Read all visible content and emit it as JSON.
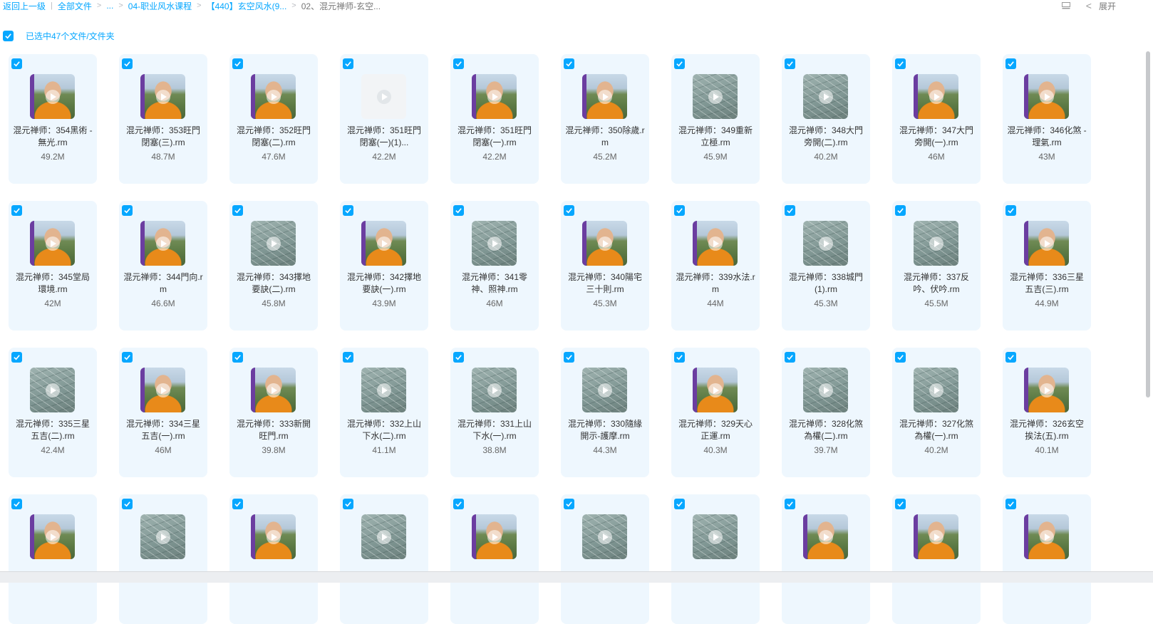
{
  "breadcrumb": {
    "back": "返回上一级",
    "divider": "|",
    "items": [
      "全部文件",
      "...",
      "04-职业风水课程",
      "【440】玄空风水(9...",
      "02、混元禅师-玄空..."
    ]
  },
  "toolbar": {
    "expand_label": "展开",
    "chevron": "<"
  },
  "selection": {
    "label": "已选中47个文件/文件夹",
    "checked": true
  },
  "colors": {
    "accent": "#06a7ff",
    "card_bg": "#eef7fe"
  },
  "files": [
    {
      "name": "混元禅师：354黑術 - 無光.rm",
      "size": "49.2M",
      "thumb": "person"
    },
    {
      "name": "混元禅师：353旺門閉塞(三).rm",
      "size": "48.7M",
      "thumb": "person"
    },
    {
      "name": "混元禅师：352旺門閉塞(二).rm",
      "size": "47.6M",
      "thumb": "person"
    },
    {
      "name": "混元禅师：351旺門閉塞(一)(1)...",
      "size": "42.2M",
      "thumb": "blank"
    },
    {
      "name": "混元禅师：351旺門閉塞(一).rm",
      "size": "42.2M",
      "thumb": "person"
    },
    {
      "name": "混元禅师：350除歲.rm",
      "size": "45.2M",
      "thumb": "person"
    },
    {
      "name": "混元禅师：349重新立極.rm",
      "size": "45.9M",
      "thumb": "board"
    },
    {
      "name": "混元禅师：348大門旁開(二).rm",
      "size": "40.2M",
      "thumb": "board"
    },
    {
      "name": "混元禅师：347大門旁開(一).rm",
      "size": "46M",
      "thumb": "person"
    },
    {
      "name": "混元禅师：346化煞 - 理氣.rm",
      "size": "43M",
      "thumb": "person"
    },
    {
      "name": "混元禅师：345堂局環境.rm",
      "size": "42M",
      "thumb": "person"
    },
    {
      "name": "混元禅师：344門向.rm",
      "size": "46.6M",
      "thumb": "person"
    },
    {
      "name": "混元禅师：343擇地要訣(二).rm",
      "size": "45.8M",
      "thumb": "board"
    },
    {
      "name": "混元禅师：342擇地要訣(一).rm",
      "size": "43.9M",
      "thumb": "person"
    },
    {
      "name": "混元禅师：341零神、照神.rm",
      "size": "46M",
      "thumb": "board"
    },
    {
      "name": "混元禅师：340陽宅三十則.rm",
      "size": "45.3M",
      "thumb": "person"
    },
    {
      "name": "混元禅师：339水法.rm",
      "size": "44M",
      "thumb": "person"
    },
    {
      "name": "混元禅师：338城門(1).rm",
      "size": "45.3M",
      "thumb": "board"
    },
    {
      "name": "混元禅师：337反吟、伏吟.rm",
      "size": "45.5M",
      "thumb": "board"
    },
    {
      "name": "混元禅师：336三星五吉(三).rm",
      "size": "44.9M",
      "thumb": "person"
    },
    {
      "name": "混元禅师：335三星五吉(二).rm",
      "size": "42.4M",
      "thumb": "board"
    },
    {
      "name": "混元禅师：334三星五吉(一).rm",
      "size": "46M",
      "thumb": "person"
    },
    {
      "name": "混元禅师：333新開旺門.rm",
      "size": "39.8M",
      "thumb": "person"
    },
    {
      "name": "混元禅师：332上山下水(二).rm",
      "size": "41.1M",
      "thumb": "board"
    },
    {
      "name": "混元禅师：331上山下水(一).rm",
      "size": "38.8M",
      "thumb": "board"
    },
    {
      "name": "混元禅师：330隨緣開示-護摩.rm",
      "size": "44.3M",
      "thumb": "board"
    },
    {
      "name": "混元禅师：329天心正運.rm",
      "size": "40.3M",
      "thumb": "person"
    },
    {
      "name": "混元禅师：328化煞為權(二).rm",
      "size": "39.7M",
      "thumb": "board"
    },
    {
      "name": "混元禅师：327化煞為權(一).rm",
      "size": "40.2M",
      "thumb": "board"
    },
    {
      "name": "混元禅师：326玄空挨法(五).rm",
      "size": "40.1M",
      "thumb": "person"
    },
    {
      "name": "",
      "size": "",
      "thumb": "person"
    },
    {
      "name": "",
      "size": "",
      "thumb": "board"
    },
    {
      "name": "",
      "size": "",
      "thumb": "person"
    },
    {
      "name": "",
      "size": "",
      "thumb": "board"
    },
    {
      "name": "",
      "size": "",
      "thumb": "person"
    },
    {
      "name": "",
      "size": "",
      "thumb": "board"
    },
    {
      "name": "",
      "size": "",
      "thumb": "board"
    },
    {
      "name": "",
      "size": "",
      "thumb": "person"
    },
    {
      "name": "",
      "size": "",
      "thumb": "person"
    },
    {
      "name": "",
      "size": "",
      "thumb": "person"
    }
  ]
}
